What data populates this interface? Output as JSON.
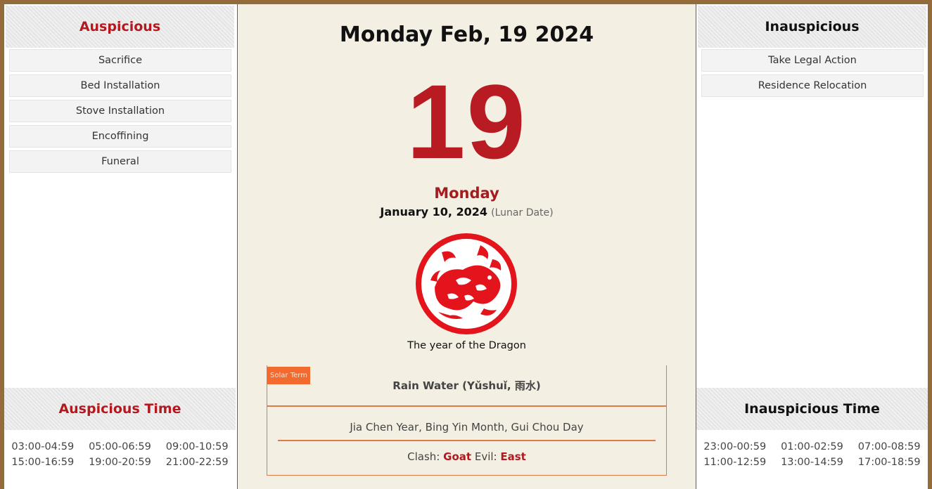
{
  "auspicious": {
    "title": "Auspicious",
    "items": [
      "Sacrifice",
      "Bed Installation",
      "Stove Installation",
      "Encoffining",
      "Funeral"
    ]
  },
  "inauspicious": {
    "title": "Inauspicious",
    "items": [
      "Take Legal Action",
      "Residence Relocation"
    ]
  },
  "auspicious_time": {
    "title": "Auspicious Time",
    "slots": [
      "03:00-04:59",
      "05:00-06:59",
      "09:00-10:59",
      "15:00-16:59",
      "19:00-20:59",
      "21:00-22:59"
    ]
  },
  "inauspicious_time": {
    "title": "Inauspicious Time",
    "slots": [
      "23:00-00:59",
      "01:00-02:59",
      "07:00-08:59",
      "11:00-12:59",
      "13:00-14:59",
      "17:00-18:59"
    ]
  },
  "center": {
    "date_title": "Monday Feb, 19 2024",
    "day_number": "19",
    "weekday": "Monday",
    "lunar_date": "January 10, 2024",
    "lunar_note": "(Lunar Date)",
    "zodiac_icon": "dragon-papercut-icon",
    "zodiac_caption": "The year of the Dragon",
    "solar_term_badge": "Solar Term",
    "solar_term": "Rain Water (Yǔshuǐ, 雨水)",
    "ganzhi": "Jia Chen Year, Bing Yin Month, Gui Chou Day",
    "clash_label": "Clash:",
    "clash_value": "Goat",
    "evil_label": "Evil:",
    "evil_value": "East"
  },
  "colors": {
    "frame": "#946b3a",
    "accent_red": "#b3191e",
    "orange": "#f26a2e",
    "paper": "#f4efe3"
  }
}
